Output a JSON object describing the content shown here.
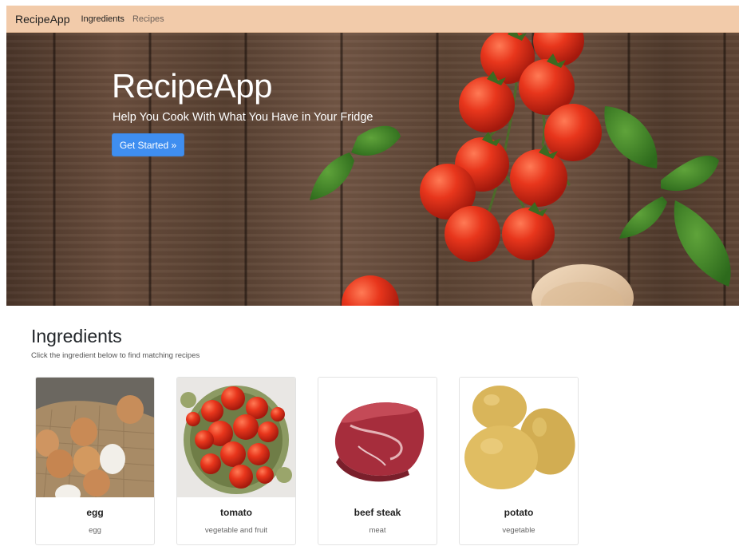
{
  "navbar": {
    "brand": "RecipeApp",
    "links": [
      {
        "label": "Ingredients",
        "active": true
      },
      {
        "label": "Recipes",
        "active": false
      }
    ],
    "background": "#f2cbaa"
  },
  "hero": {
    "title": "RecipeApp",
    "subtitle": "Help You Cook With What You Have in Your Fridge",
    "button_label": "Get Started »",
    "button_color": "#3f8ef0"
  },
  "ingredients_section": {
    "title": "Ingredients",
    "subtitle": "Click the ingredient below to find matching recipes",
    "items": [
      {
        "name": "egg",
        "category": "egg",
        "image": "eggs-image"
      },
      {
        "name": "tomato",
        "category": "vegetable and fruit",
        "image": "tomatoes-bowl-image"
      },
      {
        "name": "beef steak",
        "category": "meat",
        "image": "beef-steak-image"
      },
      {
        "name": "potato",
        "category": "vegetable",
        "image": "potatoes-image"
      }
    ]
  }
}
